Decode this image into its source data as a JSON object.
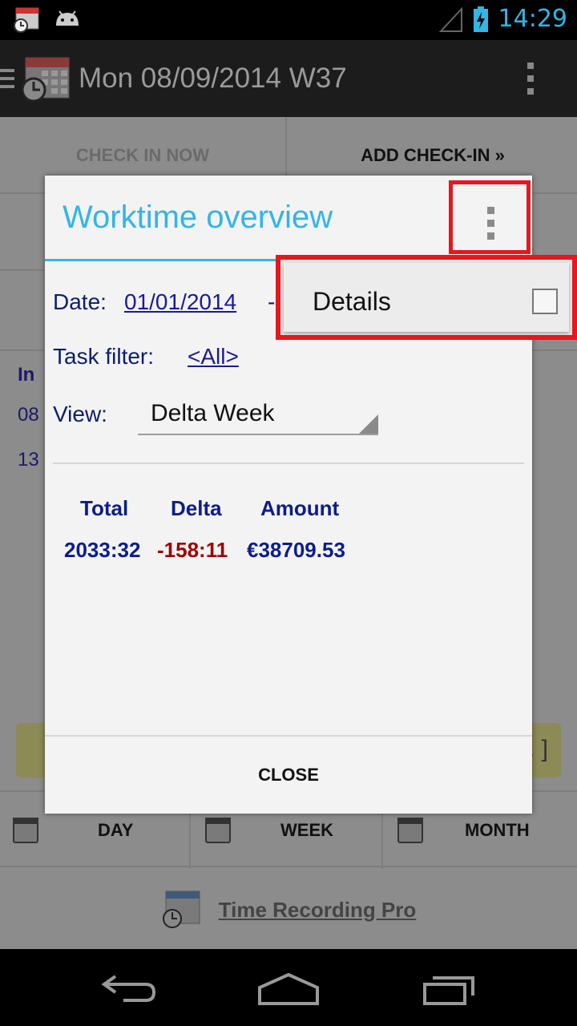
{
  "status_bar": {
    "time": "14:29"
  },
  "action_bar": {
    "title": "Mon 08/09/2014 W37"
  },
  "background": {
    "check_in_now": "CHECK IN NOW",
    "add_check_in": "ADD CHECK-IN »",
    "col_in": "In",
    "row1": "08",
    "row2": "13",
    "note_right": ". ]",
    "tabs": {
      "day": "DAY",
      "week": "WEEK",
      "month": "MONTH"
    },
    "footer_link": "Time Recording Pro"
  },
  "dialog": {
    "title": "Worktime overview",
    "date_label": "Date:",
    "date_value": "01/01/2014",
    "date_dash": "-",
    "task_filter_label": "Task filter:",
    "task_filter_value": "<All>",
    "view_label": "View:",
    "view_value": "Delta Week",
    "stats": {
      "total_header": "Total",
      "delta_header": "Delta",
      "amount_header": "Amount",
      "total_value": "2033:32",
      "delta_value": "-158:11",
      "amount_value": "€38709.53"
    },
    "close_label": "CLOSE"
  },
  "popup_menu": {
    "details_label": "Details",
    "details_checked": false
  },
  "colors": {
    "accent": "#33b5e5",
    "highlight_red": "#e8161d",
    "delta_red": "#a00000",
    "stat_blue": "#0c1d8a"
  }
}
